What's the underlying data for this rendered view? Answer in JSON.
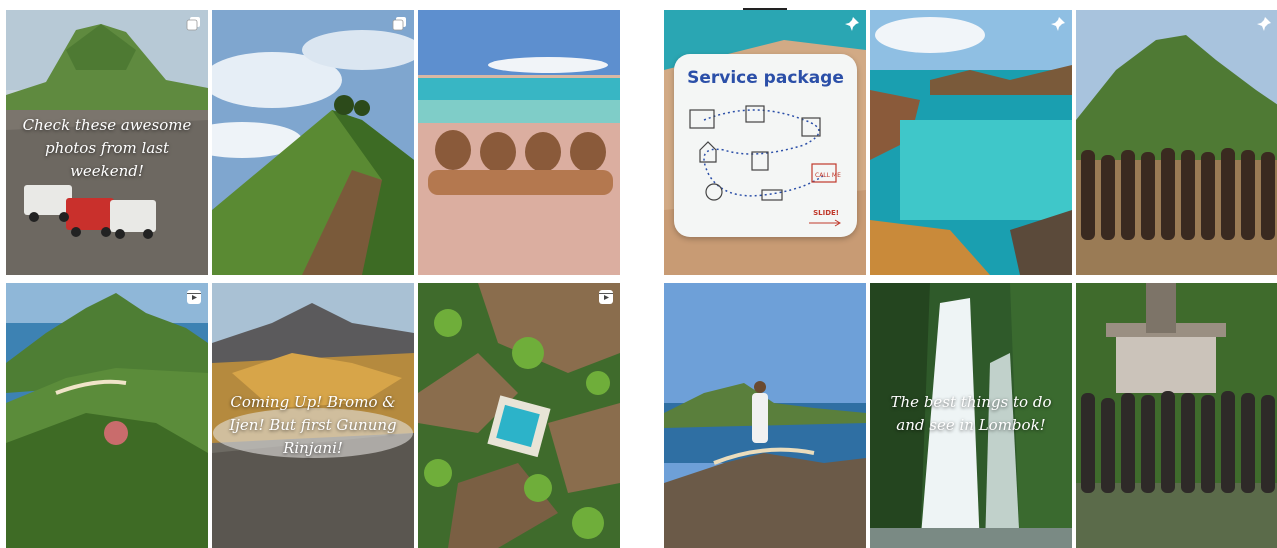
{
  "grid_left": {
    "tiles": [
      {
        "caption": "Check these awesome photos from last weekend!",
        "badge": "carousel-icon"
      },
      {
        "caption": "",
        "badge": "carousel-icon"
      },
      {
        "caption": "",
        "badge": ""
      },
      {
        "caption": "",
        "badge": "reel-icon"
      },
      {
        "caption": "Coming Up! Bromo & Ijen! But first Gunung Rinjani!",
        "badge": ""
      },
      {
        "caption": "",
        "badge": "reel-icon"
      }
    ]
  },
  "grid_right": {
    "tiles": [
      {
        "card_title": "Service package",
        "card_slide": "SLIDE!",
        "calendar_text": "CALL ME",
        "badge": "pin-icon"
      },
      {
        "caption": "",
        "badge": "pin-icon"
      },
      {
        "caption": "",
        "badge": "pin-icon"
      },
      {
        "caption": "",
        "badge": ""
      },
      {
        "caption": "The best things to do and see in Lombok!",
        "badge": ""
      },
      {
        "caption": "",
        "badge": ""
      }
    ]
  },
  "colors": {
    "sky": "#9fc4e6",
    "sea": "#1fa5b8",
    "green": "#4f7d36",
    "sand": "#d9b49a",
    "card_title": "#2b4fa8"
  }
}
